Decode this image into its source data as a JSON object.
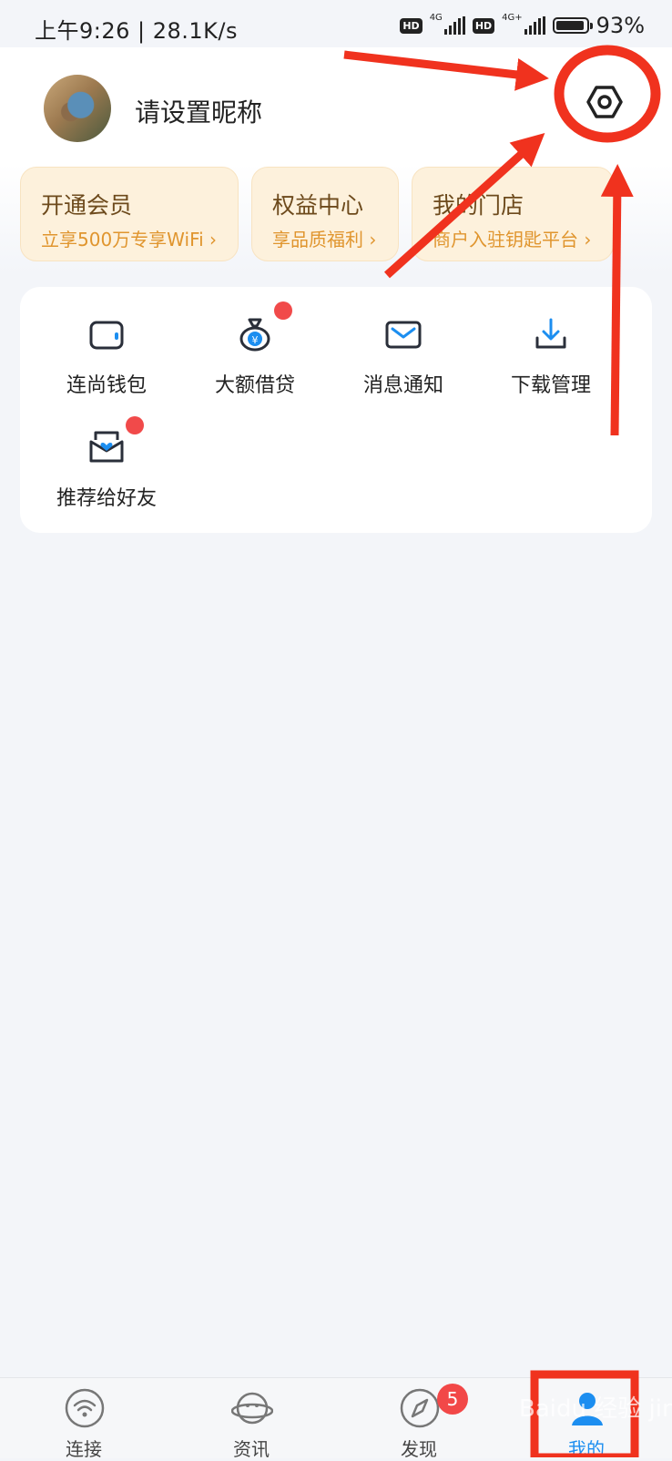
{
  "status_bar": {
    "time_speed": "上午9:26 | 28.1K/s",
    "hd1": "HD",
    "net1": "4G",
    "hd2": "HD",
    "net2": "4G+",
    "battery_percent_text": "93%",
    "battery_level": 0.93
  },
  "profile": {
    "nickname": "请设置昵称",
    "avatar_icon": "bird-avatar-photo",
    "settings_icon": "hexagon-settings-icon"
  },
  "cards": [
    {
      "title": "开通会员",
      "subtitle": "立享500万专享WiFi"
    },
    {
      "title": "权益中心",
      "subtitle": "享品质福利"
    },
    {
      "title": "我的门店",
      "subtitle": "商户入驻钥匙平台"
    }
  ],
  "functions": [
    {
      "label": "连尚钱包",
      "icon": "wallet-icon",
      "has_dot": false
    },
    {
      "label": "大额借贷",
      "icon": "money-bag-icon",
      "has_dot": true
    },
    {
      "label": "消息通知",
      "icon": "mail-icon",
      "has_dot": false
    },
    {
      "label": "下载管理",
      "icon": "download-icon",
      "has_dot": false
    },
    {
      "label": "推荐给好友",
      "icon": "recommend-heart-icon",
      "has_dot": true
    }
  ],
  "bottom_nav": [
    {
      "label": "连接",
      "icon": "wifi-icon",
      "active": false
    },
    {
      "label": "资讯",
      "icon": "planet-face-icon",
      "active": false
    },
    {
      "label": "发现",
      "icon": "compass-icon",
      "active": false,
      "badge": "5"
    },
    {
      "label": "我的",
      "icon": "user-icon",
      "active": true
    }
  ],
  "watermark": "Baidu 经验 jingyan.baidu.com",
  "colors": {
    "accent_blue": "#1c8ef0",
    "annotation_red": "#f0321e",
    "card_bg": "#fdf1dc",
    "card_subtitle": "#e0952e",
    "dot_red": "#f14a4a"
  }
}
